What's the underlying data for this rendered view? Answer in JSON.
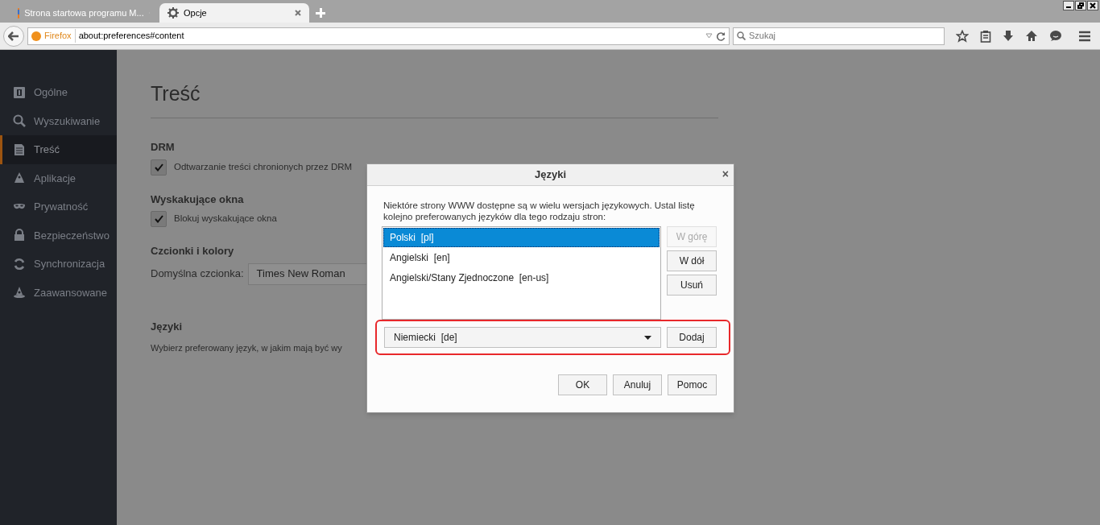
{
  "browser": {
    "tabs": [
      {
        "title": "Strona startowa programu M...",
        "selected": false
      },
      {
        "title": "Opcje",
        "selected": true
      }
    ],
    "identity": "Firefox",
    "url": "about:preferences#content",
    "search_placeholder": "Szukaj"
  },
  "sidebar": {
    "items": [
      {
        "label": "Ogólne",
        "selected": false,
        "kind": "general"
      },
      {
        "label": "Wyszukiwanie",
        "selected": false,
        "kind": "search"
      },
      {
        "label": "Treść",
        "selected": true,
        "kind": "content"
      },
      {
        "label": "Aplikacje",
        "selected": false,
        "kind": "apps"
      },
      {
        "label": "Prywatność",
        "selected": false,
        "kind": "privacy"
      },
      {
        "label": "Bezpieczeństwo",
        "selected": false,
        "kind": "security"
      },
      {
        "label": "Synchronizacja",
        "selected": false,
        "kind": "sync"
      },
      {
        "label": "Zaawansowane",
        "selected": false,
        "kind": "advanced"
      }
    ]
  },
  "content": {
    "title": "Treść",
    "sections": [
      {
        "heading": "DRM",
        "kind": "checkbox",
        "label": "Odtwarzanie treści chronionych przez DRM",
        "checked": true
      },
      {
        "heading": "Wyskakujące okna",
        "kind": "checkbox",
        "label": "Blokuj wyskakujące okna",
        "checked": true
      },
      {
        "heading": "Czcionki i kolory",
        "kind": "select",
        "label": "Domyślna czcionka:",
        "value": "Times New Roman"
      },
      {
        "heading": "Języki",
        "kind": "text",
        "text": "Wybierz preferowany język, w jakim mają być wy"
      }
    ]
  },
  "dialog": {
    "title": "Języki",
    "close": "×",
    "description": "Niektóre strony WWW dostępne są w wielu wersjach językowych. Ustal listę kolejno preferowanych języków dla tego rodzaju stron:",
    "languages": [
      {
        "label": "Polski  [pl]",
        "selected": true
      },
      {
        "label": "Angielski  [en]",
        "selected": false
      },
      {
        "label": "Angielski/Stany Zjednoczone  [en-us]",
        "selected": false
      }
    ],
    "side_buttons": [
      {
        "label": "W górę",
        "disabled": true
      },
      {
        "label": "W dół",
        "disabled": false
      },
      {
        "label": "Usuń",
        "disabled": false
      }
    ],
    "add_select": "Niemiecki  [de]",
    "add_button": "Dodaj",
    "footer_buttons": [
      "OK",
      "Anuluj",
      "Pomoc"
    ]
  }
}
